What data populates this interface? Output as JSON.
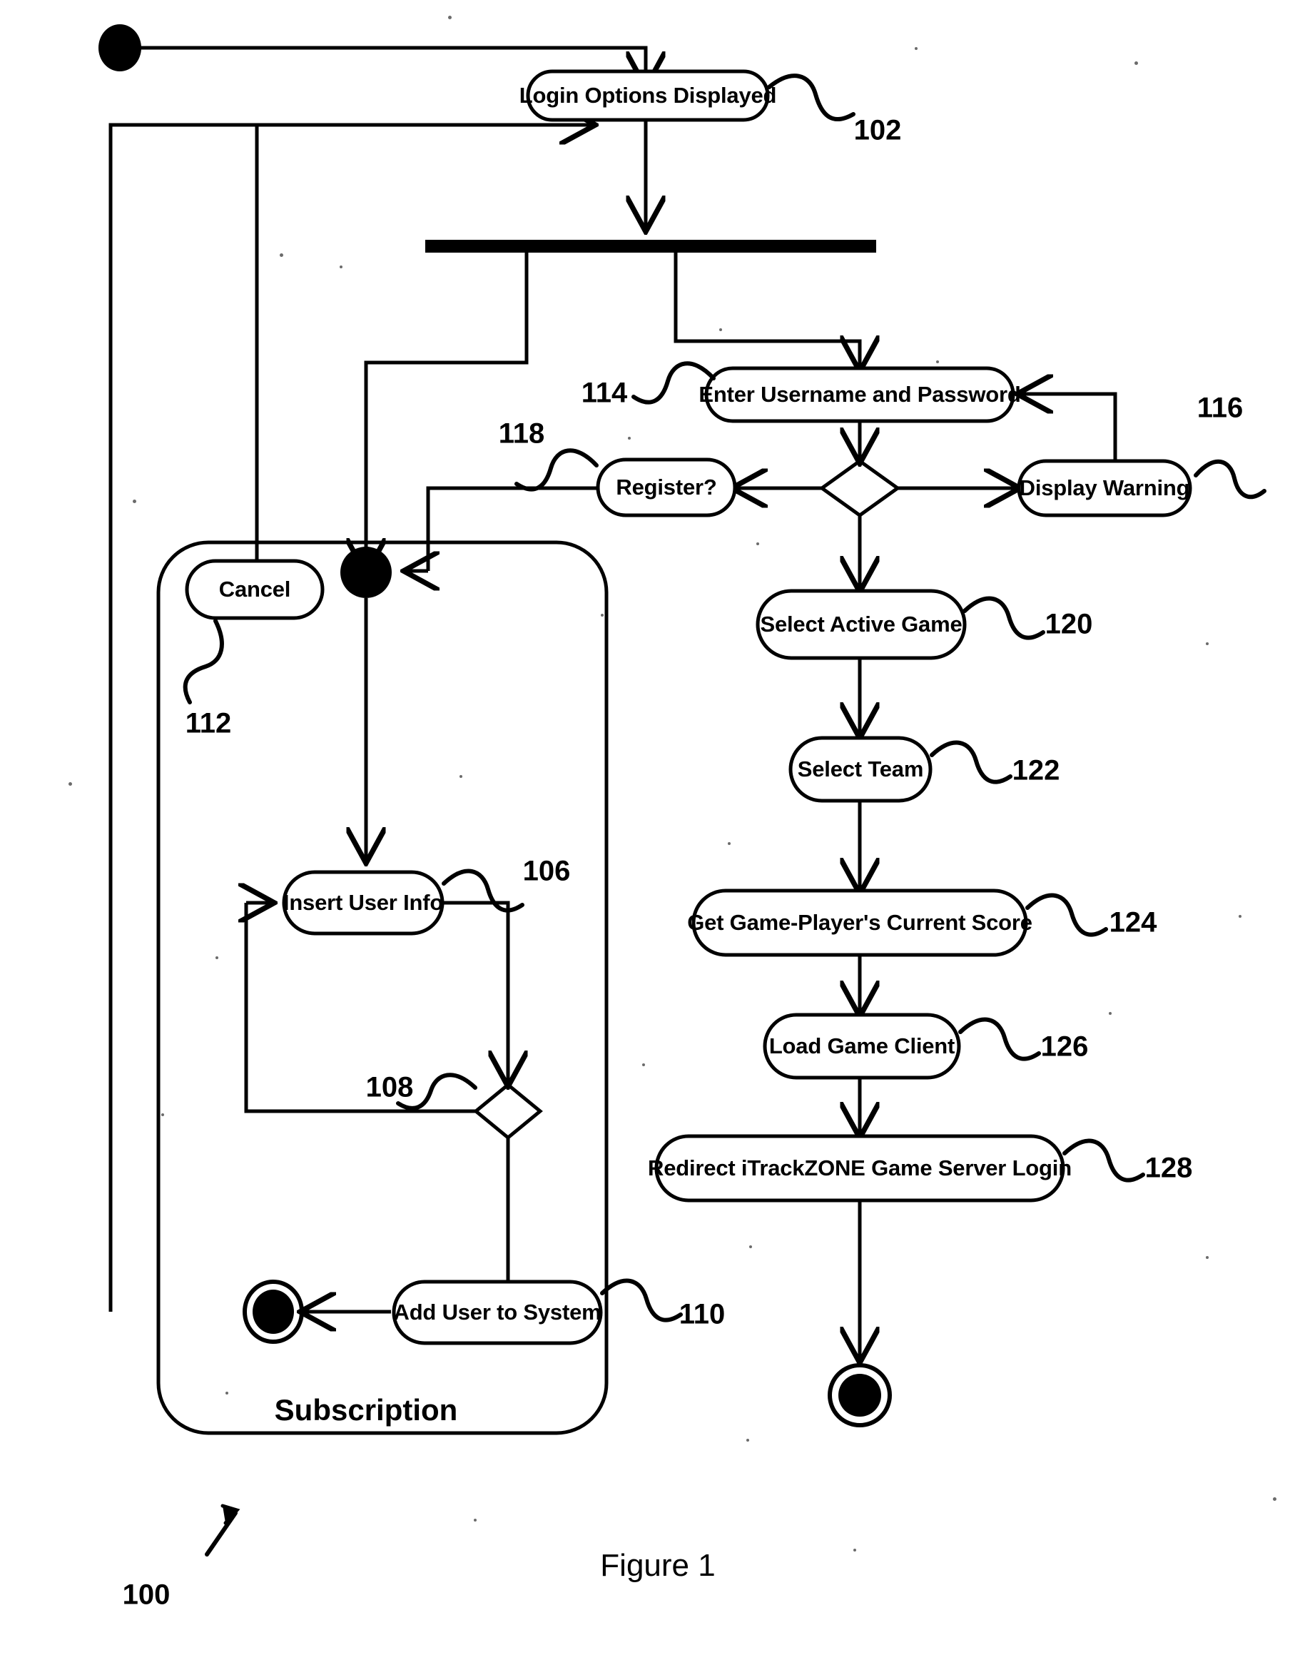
{
  "figure": {
    "caption": "Figure 1",
    "overall_ref": "100"
  },
  "region": {
    "label": "Subscription"
  },
  "nodes": [
    {
      "id": "login_options",
      "label": "Login Options Displayed",
      "ref": "102"
    },
    {
      "id": "enter_creds",
      "label": "Enter Username and Password",
      "ref": "114"
    },
    {
      "id": "register",
      "label": "Register?",
      "ref": "118"
    },
    {
      "id": "display_warning",
      "label": "Display Warning",
      "ref": "116"
    },
    {
      "id": "select_game",
      "label": "Select Active Game",
      "ref": "120"
    },
    {
      "id": "select_team",
      "label": "Select Team",
      "ref": "122"
    },
    {
      "id": "get_score",
      "label": "Get Game-Player's Current Score",
      "ref": "124"
    },
    {
      "id": "load_client",
      "label": "Load Game Client",
      "ref": "126"
    },
    {
      "id": "redirect_login",
      "label": "Redirect iTrackZONE Game Server Login",
      "ref": "128"
    },
    {
      "id": "cancel",
      "label": "Cancel",
      "ref": "112"
    },
    {
      "id": "insert_user",
      "label": "Insert User Info",
      "ref": "106"
    },
    {
      "id": "add_user",
      "label": "Add User to System",
      "ref": "110"
    }
  ],
  "decisions": [
    {
      "id": "auth_decision",
      "label": "",
      "ref": ""
    },
    {
      "id": "insert_decision",
      "label": "",
      "ref": "108"
    }
  ],
  "markers": {
    "initial_node": "initial-state",
    "fork_bar": "fork-bar",
    "subscription_initial": "subscription-initial-state",
    "subscription_final": "subscription-final-state",
    "main_final": "main-final-state"
  },
  "colors": {
    "ink": "#000000",
    "paper": "#ffffff"
  }
}
